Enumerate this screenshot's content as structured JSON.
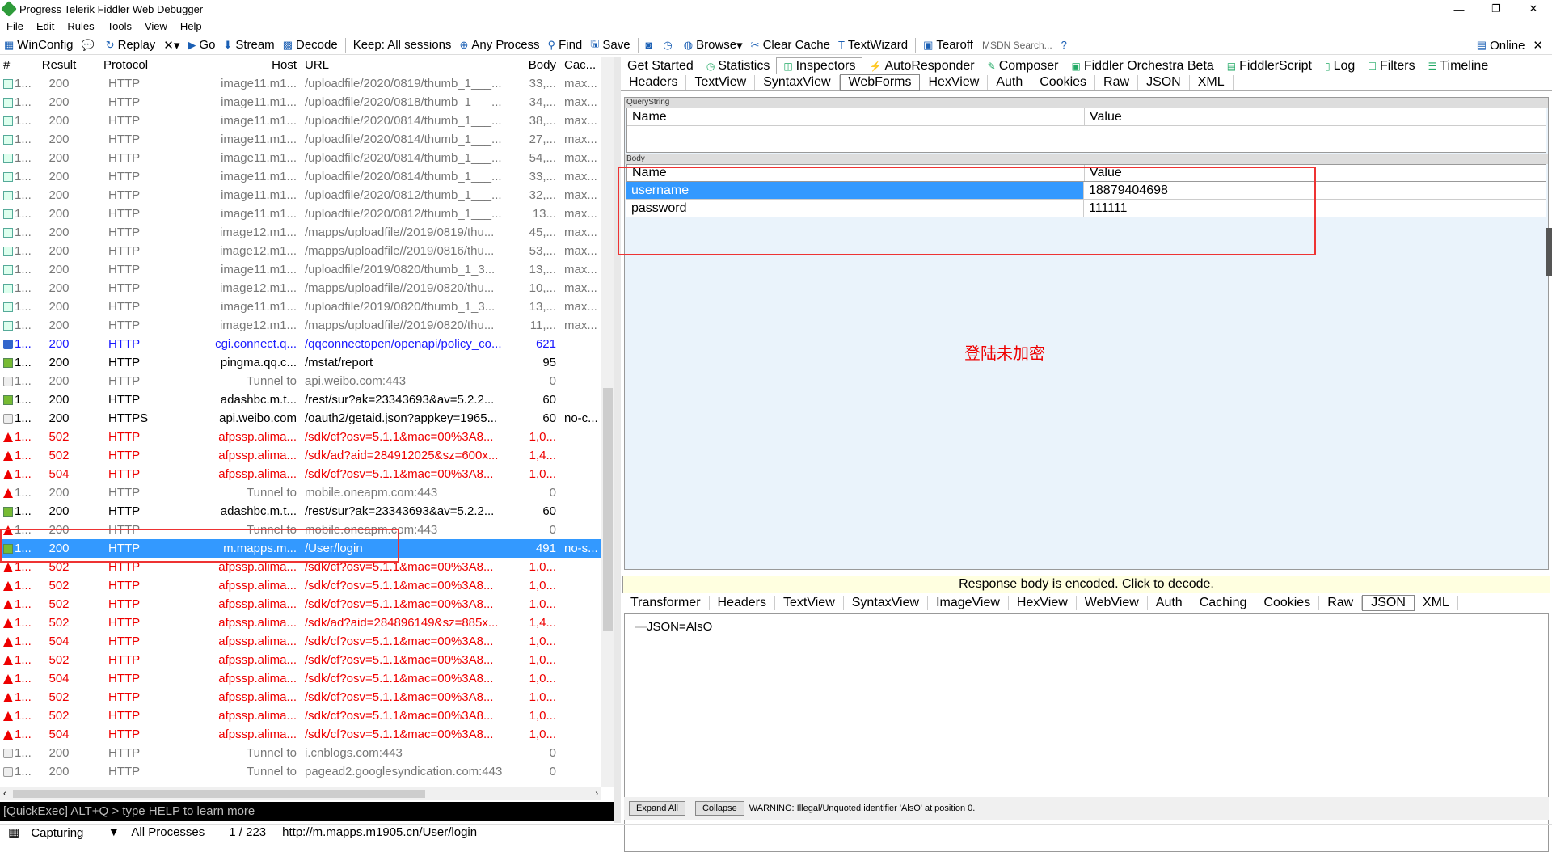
{
  "window": {
    "title": "Progress Telerik Fiddler Web Debugger",
    "min": "—",
    "max": "❐",
    "close": "✕"
  },
  "menu": [
    "File",
    "Edit",
    "Rules",
    "Tools",
    "View",
    "Help"
  ],
  "toolbar": {
    "winconfig": "WinConfig",
    "replay": "Replay",
    "remove": "✕",
    "go": "Go",
    "stream": "Stream",
    "decode": "Decode",
    "keep": "Keep: All sessions",
    "process": "Any Process",
    "find": "Find",
    "save": "Save",
    "browse": "Browse",
    "clearcache": "Clear Cache",
    "textwizard": "TextWizard",
    "tearoff": "Tearoff",
    "msdn": "MSDN Search...",
    "online": "Online"
  },
  "columns": [
    "#",
    "Result",
    "Protocol",
    "Host",
    "URL",
    "Body",
    "Cac..."
  ],
  "sessions": [
    {
      "id": "1...",
      "result": "200",
      "protocol": "HTTP",
      "host": "image11.m1...",
      "url": "/uploadfile/2020/0819/thumb_1___...",
      "body": "33,...",
      "cache": "max...",
      "style": "grey",
      "icon": "img"
    },
    {
      "id": "1...",
      "result": "200",
      "protocol": "HTTP",
      "host": "image11.m1...",
      "url": "/uploadfile/2020/0818/thumb_1___...",
      "body": "34,...",
      "cache": "max...",
      "style": "grey",
      "icon": "img"
    },
    {
      "id": "1...",
      "result": "200",
      "protocol": "HTTP",
      "host": "image11.m1...",
      "url": "/uploadfile/2020/0814/thumb_1___...",
      "body": "38,...",
      "cache": "max...",
      "style": "grey",
      "icon": "img"
    },
    {
      "id": "1...",
      "result": "200",
      "protocol": "HTTP",
      "host": "image11.m1...",
      "url": "/uploadfile/2020/0814/thumb_1___...",
      "body": "27,...",
      "cache": "max...",
      "style": "grey",
      "icon": "img"
    },
    {
      "id": "1...",
      "result": "200",
      "protocol": "HTTP",
      "host": "image11.m1...",
      "url": "/uploadfile/2020/0814/thumb_1___...",
      "body": "54,...",
      "cache": "max...",
      "style": "grey",
      "icon": "img"
    },
    {
      "id": "1...",
      "result": "200",
      "protocol": "HTTP",
      "host": "image11.m1...",
      "url": "/uploadfile/2020/0814/thumb_1___...",
      "body": "33,...",
      "cache": "max...",
      "style": "grey",
      "icon": "img"
    },
    {
      "id": "1...",
      "result": "200",
      "protocol": "HTTP",
      "host": "image11.m1...",
      "url": "/uploadfile/2020/0812/thumb_1___...",
      "body": "32,...",
      "cache": "max...",
      "style": "grey",
      "icon": "img"
    },
    {
      "id": "1...",
      "result": "200",
      "protocol": "HTTP",
      "host": "image11.m1...",
      "url": "/uploadfile/2020/0812/thumb_1___...",
      "body": "13...",
      "cache": "max...",
      "style": "grey",
      "icon": "img"
    },
    {
      "id": "1...",
      "result": "200",
      "protocol": "HTTP",
      "host": "image12.m1...",
      "url": "/mapps/uploadfile//2019/0819/thu...",
      "body": "45,...",
      "cache": "max...",
      "style": "grey",
      "icon": "img"
    },
    {
      "id": "1...",
      "result": "200",
      "protocol": "HTTP",
      "host": "image12.m1...",
      "url": "/mapps/uploadfile//2019/0816/thu...",
      "body": "53,...",
      "cache": "max...",
      "style": "grey",
      "icon": "img"
    },
    {
      "id": "1...",
      "result": "200",
      "protocol": "HTTP",
      "host": "image11.m1...",
      "url": "/uploadfile/2019/0820/thumb_1_3...",
      "body": "13,...",
      "cache": "max...",
      "style": "grey",
      "icon": "img"
    },
    {
      "id": "1...",
      "result": "200",
      "protocol": "HTTP",
      "host": "image12.m1...",
      "url": "/mapps/uploadfile//2019/0820/thu...",
      "body": "10,...",
      "cache": "max...",
      "style": "grey",
      "icon": "img"
    },
    {
      "id": "1...",
      "result": "200",
      "protocol": "HTTP",
      "host": "image11.m1...",
      "url": "/uploadfile/2019/0820/thumb_1_3...",
      "body": "13,...",
      "cache": "max...",
      "style": "grey",
      "icon": "img"
    },
    {
      "id": "1...",
      "result": "200",
      "protocol": "HTTP",
      "host": "image12.m1...",
      "url": "/mapps/uploadfile//2019/0820/thu...",
      "body": "11,...",
      "cache": "max...",
      "style": "grey",
      "icon": "img"
    },
    {
      "id": "1...",
      "result": "200",
      "protocol": "HTTP",
      "host": "cgi.connect.q...",
      "url": "/qqconnectopen/openapi/policy_co...",
      "body": "621",
      "cache": "",
      "style": "blue",
      "icon": "js"
    },
    {
      "id": "1...",
      "result": "200",
      "protocol": "HTTP",
      "host": "pingma.qq.c...",
      "url": "/mstat/report",
      "body": "95",
      "cache": "",
      "style": "black",
      "icon": "get"
    },
    {
      "id": "1...",
      "result": "200",
      "protocol": "HTTP",
      "host": "Tunnel to",
      "url": "api.weibo.com:443",
      "body": "0",
      "cache": "",
      "style": "grey",
      "icon": "lock"
    },
    {
      "id": "1...",
      "result": "200",
      "protocol": "HTTP",
      "host": "adashbc.m.t...",
      "url": "/rest/sur?ak=23343693&av=5.2.2...",
      "body": "60",
      "cache": "",
      "style": "black",
      "icon": "get"
    },
    {
      "id": "1...",
      "result": "200",
      "protocol": "HTTPS",
      "host": "api.weibo.com",
      "url": "/oauth2/getaid.json?appkey=1965...",
      "body": "60",
      "cache": "no-c...",
      "style": "black",
      "icon": "lock"
    },
    {
      "id": "1...",
      "result": "502",
      "protocol": "HTTP",
      "host": "afpssp.alima...",
      "url": "/sdk/cf?osv=5.1.1&mac=00%3A8...",
      "body": "1,0...",
      "cache": "",
      "style": "red",
      "icon": "warn"
    },
    {
      "id": "1...",
      "result": "502",
      "protocol": "HTTP",
      "host": "afpssp.alima...",
      "url": "/sdk/ad?aid=284912025&sz=600x...",
      "body": "1,4...",
      "cache": "",
      "style": "red",
      "icon": "warn"
    },
    {
      "id": "1...",
      "result": "504",
      "protocol": "HTTP",
      "host": "afpssp.alima...",
      "url": "/sdk/cf?osv=5.1.1&mac=00%3A8...",
      "body": "1,0...",
      "cache": "",
      "style": "red",
      "icon": "warn"
    },
    {
      "id": "1...",
      "result": "200",
      "protocol": "HTTP",
      "host": "Tunnel to",
      "url": "mobile.oneapm.com:443",
      "body": "0",
      "cache": "",
      "style": "grey",
      "icon": "warn"
    },
    {
      "id": "1...",
      "result": "200",
      "protocol": "HTTP",
      "host": "adashbc.m.t...",
      "url": "/rest/sur?ak=23343693&av=5.2.2...",
      "body": "60",
      "cache": "",
      "style": "black",
      "icon": "get"
    },
    {
      "id": "1...",
      "result": "200",
      "protocol": "HTTP",
      "host": "Tunnel to",
      "url": "mobile.oneapm.com:443",
      "body": "0",
      "cache": "",
      "style": "grey",
      "icon": "warn"
    },
    {
      "id": "1...",
      "result": "200",
      "protocol": "HTTP",
      "host": "m.mapps.m...",
      "url": "/User/login",
      "body": "491",
      "cache": "no-s...",
      "style": "sel",
      "icon": "get"
    },
    {
      "id": "1...",
      "result": "502",
      "protocol": "HTTP",
      "host": "afpssp.alima...",
      "url": "/sdk/cf?osv=5.1.1&mac=00%3A8...",
      "body": "1,0...",
      "cache": "",
      "style": "red",
      "icon": "warn"
    },
    {
      "id": "1...",
      "result": "502",
      "protocol": "HTTP",
      "host": "afpssp.alima...",
      "url": "/sdk/cf?osv=5.1.1&mac=00%3A8...",
      "body": "1,0...",
      "cache": "",
      "style": "red",
      "icon": "warn"
    },
    {
      "id": "1...",
      "result": "502",
      "protocol": "HTTP",
      "host": "afpssp.alima...",
      "url": "/sdk/cf?osv=5.1.1&mac=00%3A8...",
      "body": "1,0...",
      "cache": "",
      "style": "red",
      "icon": "warn"
    },
    {
      "id": "1...",
      "result": "502",
      "protocol": "HTTP",
      "host": "afpssp.alima...",
      "url": "/sdk/ad?aid=284896149&sz=885x...",
      "body": "1,4...",
      "cache": "",
      "style": "red",
      "icon": "warn"
    },
    {
      "id": "1...",
      "result": "504",
      "protocol": "HTTP",
      "host": "afpssp.alima...",
      "url": "/sdk/cf?osv=5.1.1&mac=00%3A8...",
      "body": "1,0...",
      "cache": "",
      "style": "red",
      "icon": "warn"
    },
    {
      "id": "1...",
      "result": "502",
      "protocol": "HTTP",
      "host": "afpssp.alima...",
      "url": "/sdk/cf?osv=5.1.1&mac=00%3A8...",
      "body": "1,0...",
      "cache": "",
      "style": "red",
      "icon": "warn"
    },
    {
      "id": "1...",
      "result": "504",
      "protocol": "HTTP",
      "host": "afpssp.alima...",
      "url": "/sdk/cf?osv=5.1.1&mac=00%3A8...",
      "body": "1,0...",
      "cache": "",
      "style": "red",
      "icon": "warn"
    },
    {
      "id": "1...",
      "result": "502",
      "protocol": "HTTP",
      "host": "afpssp.alima...",
      "url": "/sdk/cf?osv=5.1.1&mac=00%3A8...",
      "body": "1,0...",
      "cache": "",
      "style": "red",
      "icon": "warn"
    },
    {
      "id": "1...",
      "result": "502",
      "protocol": "HTTP",
      "host": "afpssp.alima...",
      "url": "/sdk/cf?osv=5.1.1&mac=00%3A8...",
      "body": "1,0...",
      "cache": "",
      "style": "red",
      "icon": "warn"
    },
    {
      "id": "1...",
      "result": "504",
      "protocol": "HTTP",
      "host": "afpssp.alima...",
      "url": "/sdk/cf?osv=5.1.1&mac=00%3A8...",
      "body": "1,0...",
      "cache": "",
      "style": "red",
      "icon": "warn"
    },
    {
      "id": "1...",
      "result": "200",
      "protocol": "HTTP",
      "host": "Tunnel to",
      "url": "i.cnblogs.com:443",
      "body": "0",
      "cache": "",
      "style": "grey",
      "icon": "lock"
    },
    {
      "id": "1...",
      "result": "200",
      "protocol": "HTTP",
      "host": "Tunnel to",
      "url": "pagead2.googlesyndication.com:443",
      "body": "0",
      "cache": "",
      "style": "grey",
      "icon": "lock"
    }
  ],
  "quickexec": "[QuickExec] ALT+Q > type HELP to learn more",
  "status": {
    "capturing": "Capturing",
    "processes": "All Processes",
    "count": "1 / 223",
    "url": "http://m.mapps.m1905.cn/User/login"
  },
  "tabs": [
    "Get Started",
    "Statistics",
    "Inspectors",
    "AutoResponder",
    "Composer",
    "Fiddler Orchestra Beta",
    "FiddlerScript",
    "Log",
    "Filters",
    "Timeline"
  ],
  "reqtabs": [
    "Headers",
    "TextView",
    "SyntaxView",
    "WebForms",
    "HexView",
    "Auth",
    "Cookies",
    "Raw",
    "JSON",
    "XML"
  ],
  "querystring": {
    "label": "QueryString",
    "name": "Name",
    "value": "Value"
  },
  "body": {
    "label": "Body",
    "name": "Name",
    "value": "Value",
    "rows": [
      {
        "name": "username",
        "value": "18879404698"
      },
      {
        "name": "password",
        "value": "111111"
      }
    ]
  },
  "annotation": "登陆未加密",
  "encoded": "Response body is encoded. Click to decode.",
  "restabs": [
    "Transformer",
    "Headers",
    "TextView",
    "SyntaxView",
    "ImageView",
    "HexView",
    "WebView",
    "Auth",
    "Caching",
    "Cookies",
    "Raw",
    "JSON",
    "XML"
  ],
  "jsonnode": "JSON=AlsO",
  "expand": "Expand All",
  "collapse": "Collapse",
  "warning": "WARNING: Illegal/Unquoted identifier 'AlsO' at position 0."
}
